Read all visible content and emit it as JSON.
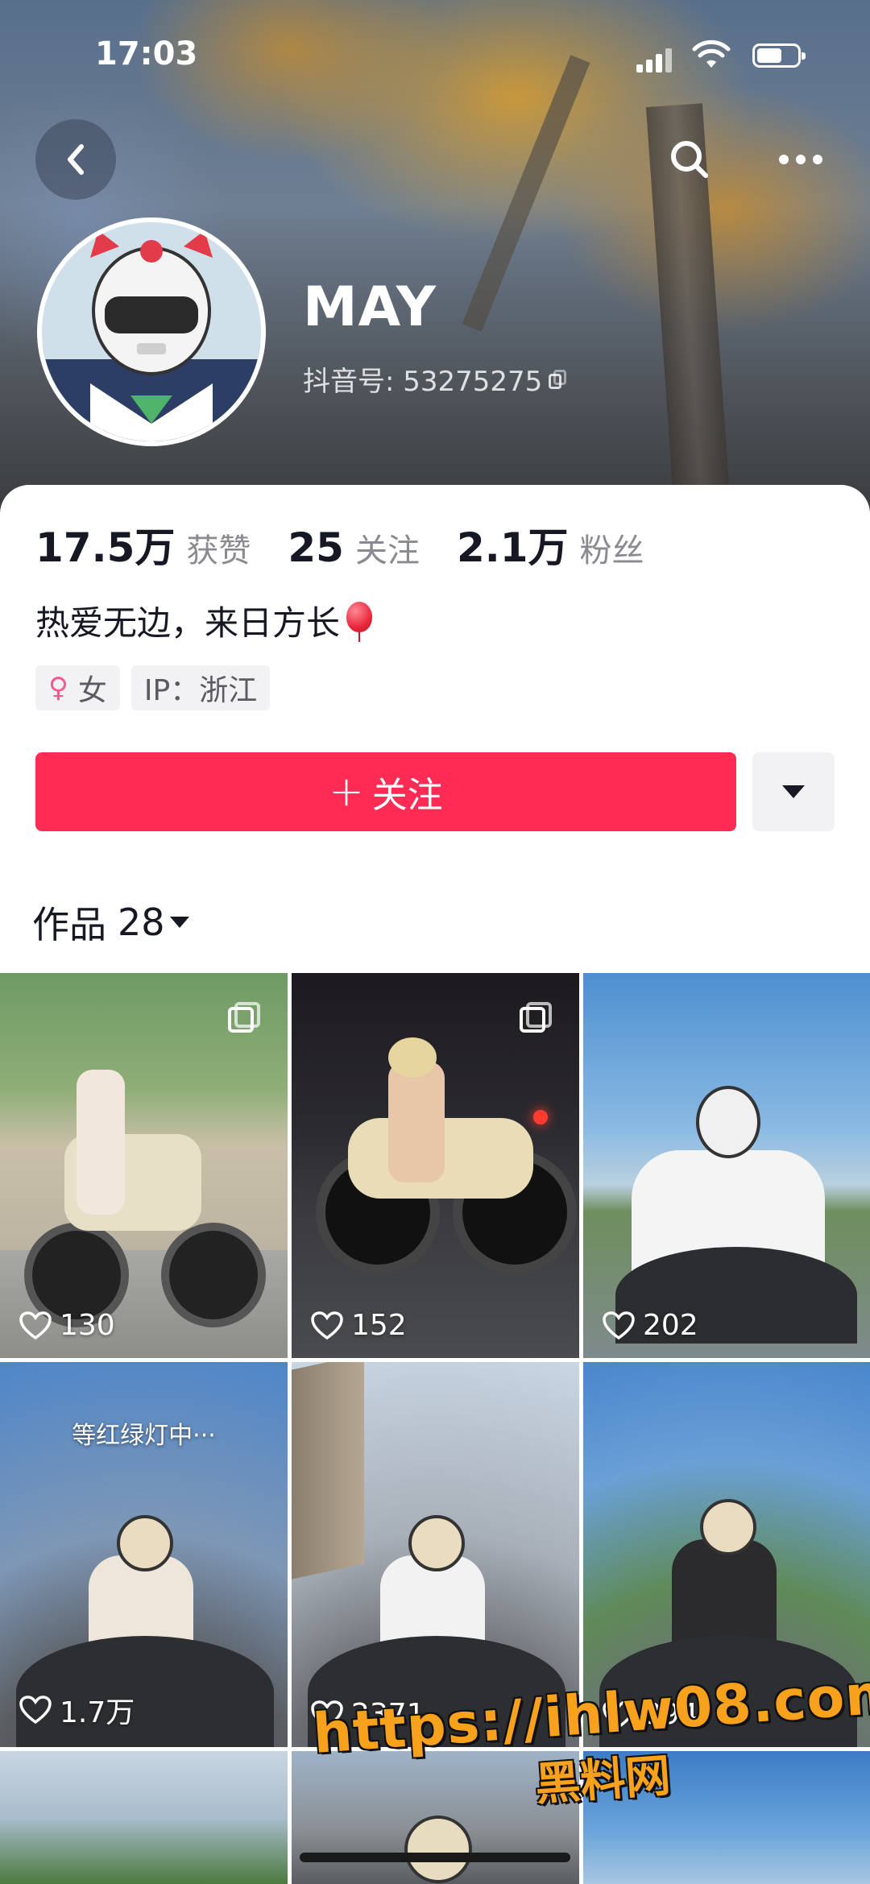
{
  "status_bar": {
    "time": "17:03"
  },
  "profile": {
    "name": "MAY",
    "handle_label": "抖音号: 53275275",
    "bio": "热爱无边，来日方长",
    "gender_label": "女",
    "ip_label": "IP：浙江"
  },
  "stats": [
    {
      "value": "17.5万",
      "label": "获赞"
    },
    {
      "value": "25",
      "label": "关注"
    },
    {
      "value": "2.1万",
      "label": "粉丝"
    }
  ],
  "actions": {
    "follow_label": "关注"
  },
  "works": {
    "label": "作品",
    "count": "28"
  },
  "videos": [
    {
      "likes": "130",
      "multi": true
    },
    {
      "likes": "152",
      "multi": true
    },
    {
      "likes": "202",
      "multi": false
    },
    {
      "likes": "1.7万",
      "multi": false,
      "caption": "等红绿灯中···"
    },
    {
      "likes": "2371",
      "multi": false
    },
    {
      "likes": "894",
      "multi": false
    }
  ],
  "watermark": {
    "line1": "https://ihlw08.com",
    "line2": "黑料网"
  },
  "colors": {
    "accent": "#fe2c55",
    "watermark": "#f7a11c"
  }
}
